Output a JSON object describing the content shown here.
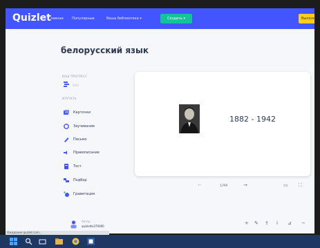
{
  "header": {
    "logo": "Quizlet",
    "nav": [
      "Главная",
      "Популярные",
      "Ваша библиотека ▾"
    ],
    "create_label": "Создать ▾",
    "upgrade_label": "Выполнить"
  },
  "set": {
    "title": "белорусский язык"
  },
  "sidebar": {
    "progress_caption": "ВАШ ПРОГРЕСС",
    "progress_value": "0/44",
    "study_caption": "ИЗУЧАТЬ",
    "modes": [
      {
        "label": "Карточки",
        "icon": "cards-icon"
      },
      {
        "label": "Заучивание",
        "icon": "learn-icon"
      },
      {
        "label": "Письмо",
        "icon": "write-icon"
      },
      {
        "label": "Правописание",
        "icon": "spell-icon"
      },
      {
        "label": "Тест",
        "icon": "test-icon"
      },
      {
        "label": "Подбор",
        "icon": "match-icon"
      },
      {
        "label": "Гравитация",
        "icon": "gravity-icon"
      }
    ]
  },
  "card": {
    "text": "1882 - 1942",
    "counter": "1/44"
  },
  "author": {
    "caption": "Автор",
    "name": "quizlette370000"
  },
  "statusbar": {
    "text": "Ожидание quizlet.com..."
  },
  "colors": {
    "brand": "#4255ff",
    "create": "#15c39a",
    "upgrade": "#ffcd1f",
    "text": "#2e3856"
  }
}
